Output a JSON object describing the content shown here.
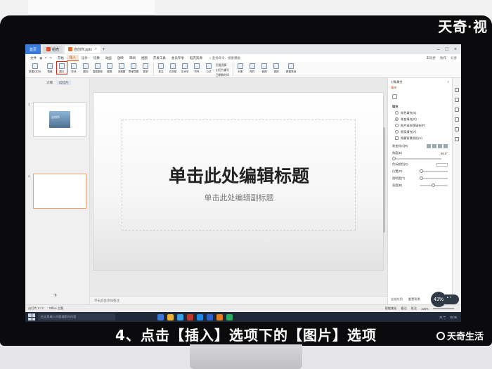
{
  "watermark_top": "天奇·视",
  "app": {
    "home_tab": "首页",
    "tabs": [
      {
        "label": "稻壳",
        "icon_color": "#e24b2c"
      },
      {
        "label": "自创作.pptx",
        "icon_color": "#e36c26"
      }
    ],
    "new_tab": "+"
  },
  "menu": {
    "file": "文件",
    "items": [
      "开始",
      "插入",
      "设计",
      "切换",
      "动画",
      "放映",
      "审阅",
      "视图",
      "开发工具",
      "会员专享",
      "稻壳资源"
    ],
    "active_index": 1,
    "search": "查找命令、搜索模板",
    "right": [
      "未同步",
      "协作",
      "分享"
    ]
  },
  "ribbon": {
    "buttons": [
      "新建幻灯片",
      "表格",
      "图片",
      "形状",
      "图标",
      "智能图形",
      "图表",
      "流程图",
      "思维导图",
      "更多"
    ],
    "highlight_index": 2,
    "group2": [
      "批注",
      "文本框",
      "艺术字",
      "符号",
      "公式"
    ],
    "text_rows": [
      "页眉页脚",
      "幻灯片编号",
      "日期和时间"
    ],
    "group3": [
      "对象",
      "附件",
      "音频",
      "视频",
      "屏幕录制"
    ]
  },
  "left_pane": {
    "tabs": [
      "大纲",
      "幻灯片"
    ],
    "slides": [
      {
        "num": "1",
        "thumb_text": "自创作"
      },
      {
        "num": "2",
        "thumb_text": ""
      }
    ],
    "add": "+"
  },
  "slide": {
    "title": "单击此处编辑标题",
    "subtitle": "单击此处编辑副标题"
  },
  "notes_placeholder": "单击此处添加备注",
  "right_pane": {
    "header": "对象属性",
    "sub_header": "填充",
    "section": "填充",
    "fill_options": [
      "纯色填充(S)",
      "渐变填充(G)",
      "图片或纹理填充(P)",
      "图案填充(A)",
      "隐藏背景图形(H)"
    ],
    "selected_fill": 1,
    "rows": [
      "渐变样式(R)",
      "角度(E)",
      "色标颜色(C)",
      "位置(O)",
      "透明度(T)",
      "亮度(B)"
    ],
    "angle_value": "90.0°",
    "footer": [
      "全部应用",
      "重置背景"
    ]
  },
  "status": {
    "left": [
      "幻灯片 2 / 2",
      "Office 主题"
    ],
    "right": [
      "智能美化",
      "备注",
      "批注",
      "100%"
    ]
  },
  "badge": {
    "value": "43",
    "unit": "%"
  },
  "taskbar": {
    "search": "在这里输入你要搜索的内容",
    "app_colors": [
      "#3b78d8",
      "#f2b233",
      "#3aa0e8",
      "#c0392b",
      "#1e88e5",
      "#2a62c9",
      "#e67e22",
      "#27ae60"
    ],
    "tray": [
      "21°C",
      "15:36"
    ]
  },
  "caption": "4、点击【插入】选项下的【图片】选项",
  "brand_bottom": "天奇生活"
}
